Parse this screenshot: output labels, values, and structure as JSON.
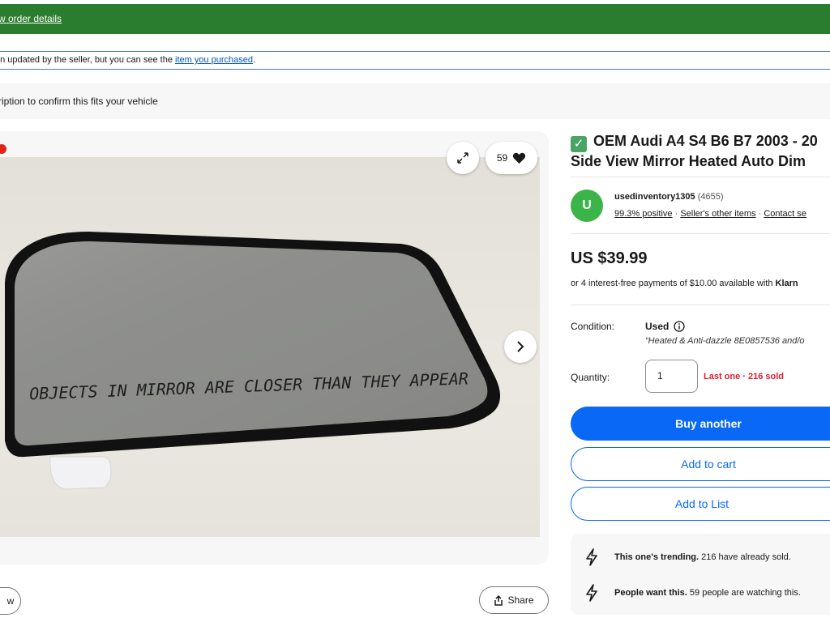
{
  "banner": {
    "link_text": "w order details"
  },
  "notice": {
    "text_before": "en updated by the seller, but you can see the ",
    "link_text": "item you purchased",
    "text_after": "."
  },
  "fitment": {
    "text": "ription to confirm this fits your vehicle"
  },
  "gallery": {
    "watchers_count": "59",
    "mirror_text": "OBJECTS IN MIRROR ARE CLOSER THAN THEY APPEAR",
    "view_button_partial": "w",
    "share_label": "Share"
  },
  "listing": {
    "title_line1": "OEM Audi A4 S4 B6 B7 2003 - 20",
    "title_line2": "Side View Mirror Heated Auto Dim"
  },
  "seller": {
    "avatar_letter": "U",
    "name": "usedinventory1305",
    "feedback_count": "(4655)",
    "positive": "99.3% positive",
    "sep": " · ",
    "other_items": "Seller's other items",
    "contact": "Contact se"
  },
  "price": {
    "amount": "US $39.99",
    "installments_text": "or 4 interest-free payments of $10.00 available with ",
    "installments_brand": "Klarn"
  },
  "condition": {
    "label": "Condition:",
    "value": "Used",
    "note": "“Heated & Anti-dazzle 8E0857536 and/o"
  },
  "quantity": {
    "label": "Quantity:",
    "value": "1",
    "stock_text": "Last one · 216 sold"
  },
  "actions": {
    "buy": "Buy another",
    "cart": "Add to cart",
    "list": "Add to List"
  },
  "signals": [
    {
      "bold": "This one's trending.",
      "rest": " 216 have already sold."
    },
    {
      "bold": "People want this.",
      "rest": " 59 people are watching this."
    }
  ],
  "colors": {
    "banner": "#2a7d2e",
    "primary": "#0968f6",
    "stock": "#dd1e31",
    "avatar": "#3bb54a",
    "check": "#4aa564"
  }
}
